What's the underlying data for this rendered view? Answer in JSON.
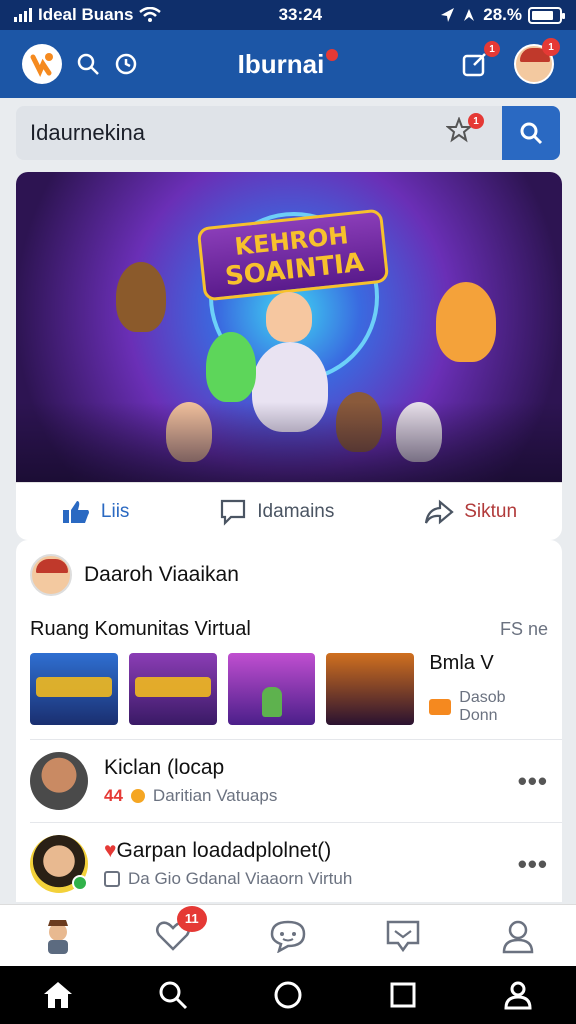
{
  "status_bar": {
    "carrier": "Ideal Buans",
    "time": "33:24",
    "battery_text": "28.%",
    "battery_level": 0.8
  },
  "header": {
    "title": "Iburnai",
    "edit_badge": "1",
    "avatar_badge": "1"
  },
  "search": {
    "value": "Idaurnekina",
    "star_badge": "1"
  },
  "hero": {
    "banner_line1": "KEHROH",
    "banner_line2": "SOAINTIA"
  },
  "actions": [
    {
      "label": "Liis",
      "color": "#2a69c2"
    },
    {
      "label": "Idamains",
      "color": "#4b5563"
    },
    {
      "label": "Siktun",
      "color": "#b13a3a"
    }
  ],
  "post": {
    "author": "Daaroh Viaaikan",
    "community_title": "Ruang Komunitas Virtual",
    "community_side": "FS ne",
    "side_title": "Bmla V",
    "side_sub": "Dasob Donn"
  },
  "list": [
    {
      "title": "Kiclan (locap",
      "subtitle": "Daritian Vatuaps",
      "prefix": "44"
    },
    {
      "title": "Garpan loadadplolnet()",
      "subtitle": "Da Gio Gdanal Viaaorn Virtuh",
      "prefix": ""
    }
  ],
  "bottom_nav": {
    "badge": "11"
  },
  "colors": {
    "header_bg": "#1c56a6",
    "accent": "#2a69c2",
    "badge": "#e53935"
  },
  "icons": [
    "search-icon",
    "star-icon",
    "edit-icon",
    "like-icon",
    "comment-icon",
    "share-icon",
    "heart-icon",
    "chat-icon",
    "message-icon",
    "profile-icon",
    "home-icon",
    "recent-apps-icon"
  ]
}
